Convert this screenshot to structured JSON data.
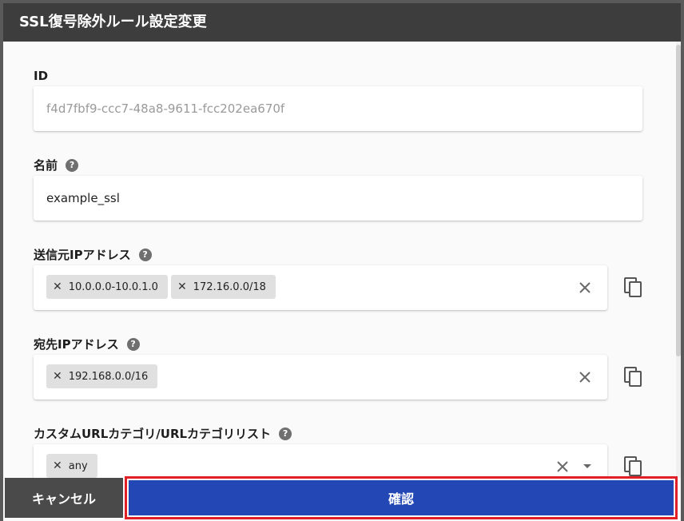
{
  "dialog": {
    "title": "SSL復号除外ルール設定変更"
  },
  "fields": {
    "id": {
      "label": "ID",
      "value": "f4d7fbf9-ccc7-48a8-9611-fcc202ea670f"
    },
    "name": {
      "label": "名前",
      "help_icon": "?",
      "value": "example_ssl"
    },
    "source_ip": {
      "label": "送信元IPアドレス",
      "help_icon": "?",
      "chips": [
        "10.0.0.0-10.0.1.0",
        "172.16.0.0/18"
      ]
    },
    "destination_ip": {
      "label": "宛先IPアドレス",
      "help_icon": "?",
      "chips": [
        "192.168.0.0/16"
      ]
    },
    "url_category": {
      "label": "カスタムURLカテゴリ/URLカテゴリリスト",
      "help_icon": "?",
      "chips": [
        "any"
      ]
    }
  },
  "chip_remove_glyph": "✕",
  "footer": {
    "cancel_label": "キャンセル",
    "confirm_label": "確認"
  },
  "colors": {
    "title_bar": "#3d3d3d",
    "confirm": "#2348b5",
    "cancel": "#4a4a4a",
    "highlight": "#e01f26"
  }
}
